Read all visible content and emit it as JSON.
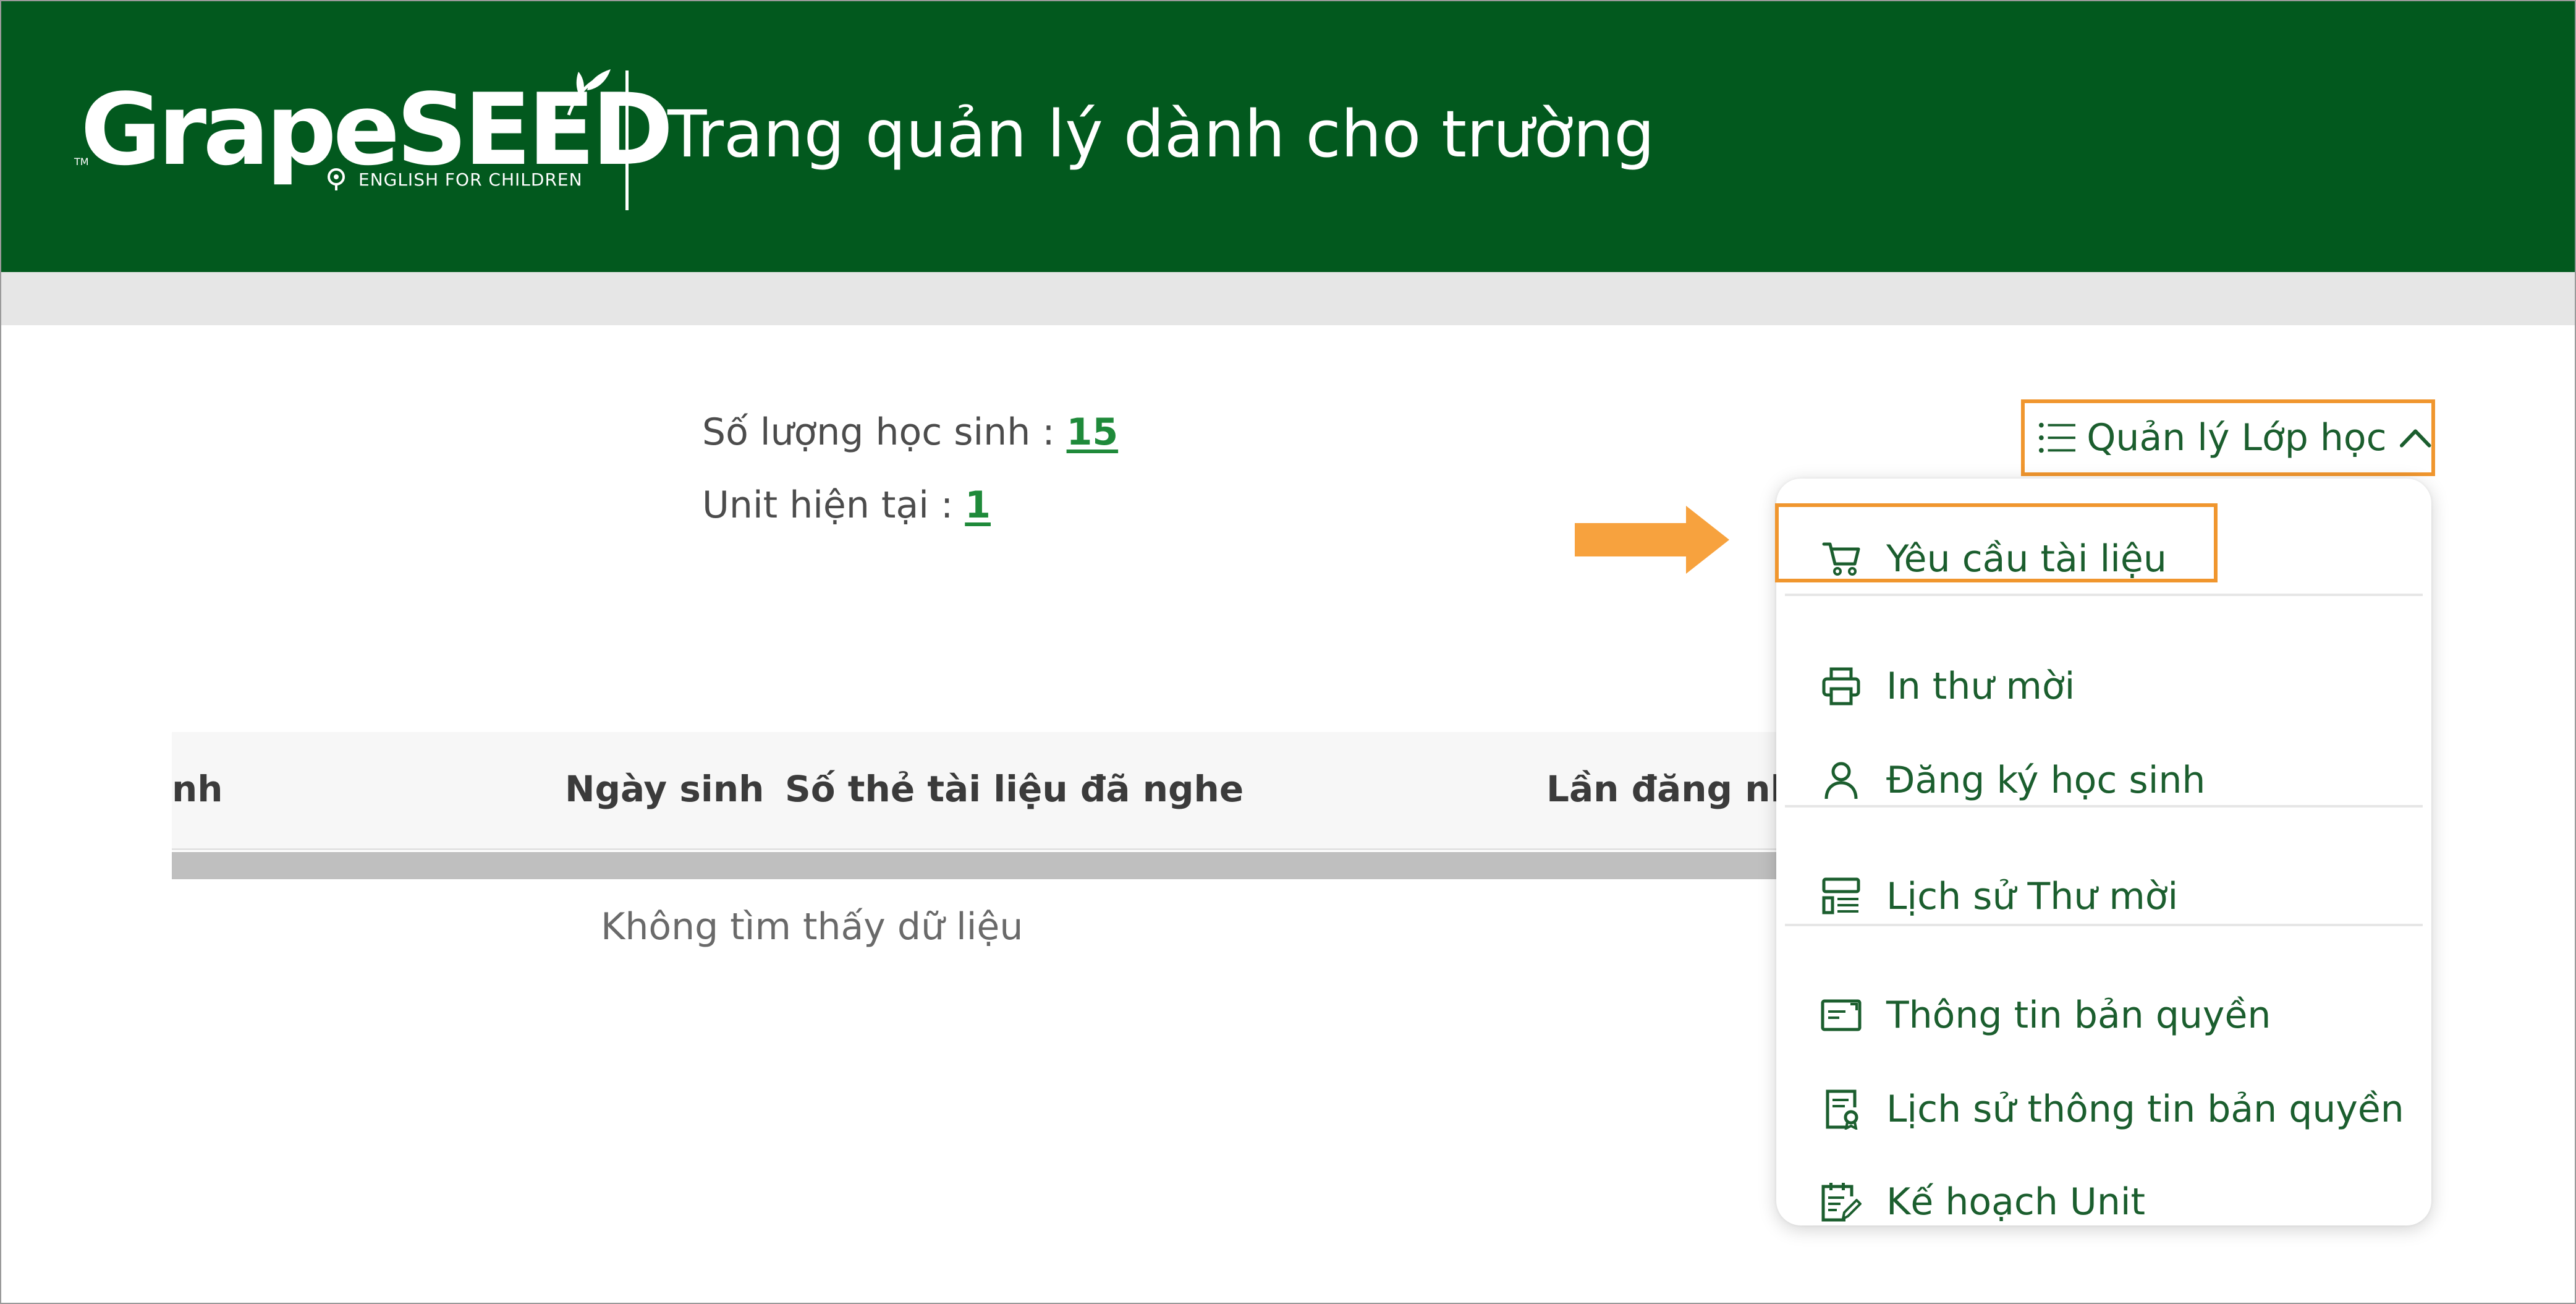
{
  "header": {
    "logo": {
      "wordmark": "GrapeSEED",
      "tagline": "ENGLISH FOR CHILDREN",
      "tm": "TM"
    },
    "title": "Trang quản lý dành cho trường"
  },
  "stats": {
    "student_count_label": "Số lượng học sinh :",
    "student_count_value": "15",
    "current_unit_label": "Unit hiện tại :",
    "current_unit_value": "1"
  },
  "class_menu": {
    "label": "Quản lý Lớp học",
    "items": [
      {
        "label": "Yêu cầu tài liệu",
        "icon": "cart-icon"
      },
      {
        "label": "In thư mời",
        "icon": "printer-icon"
      },
      {
        "label": "Đăng ký học sinh",
        "icon": "user-icon"
      },
      {
        "label": "Lịch sử Thư mời",
        "icon": "invite-history-icon"
      },
      {
        "label": "Thông tin bản quyền",
        "icon": "license-card-icon"
      },
      {
        "label": "Lịch sử thông tin bản quyền",
        "icon": "license-history-icon"
      },
      {
        "label": "Kế hoạch Unit",
        "icon": "unit-plan-icon"
      }
    ]
  },
  "table": {
    "columns": [
      "nh",
      "Ngày sinh",
      "Số thẻ tài liệu đã nghe",
      "Lần đăng nh"
    ],
    "empty_text": "Không tìm thấy dữ liệu"
  },
  "colors": {
    "header_green": "#02591e",
    "accent_orange": "#f0962e",
    "menu_text_green": "#1b5e2e",
    "link_green": "#1f8a3a"
  }
}
